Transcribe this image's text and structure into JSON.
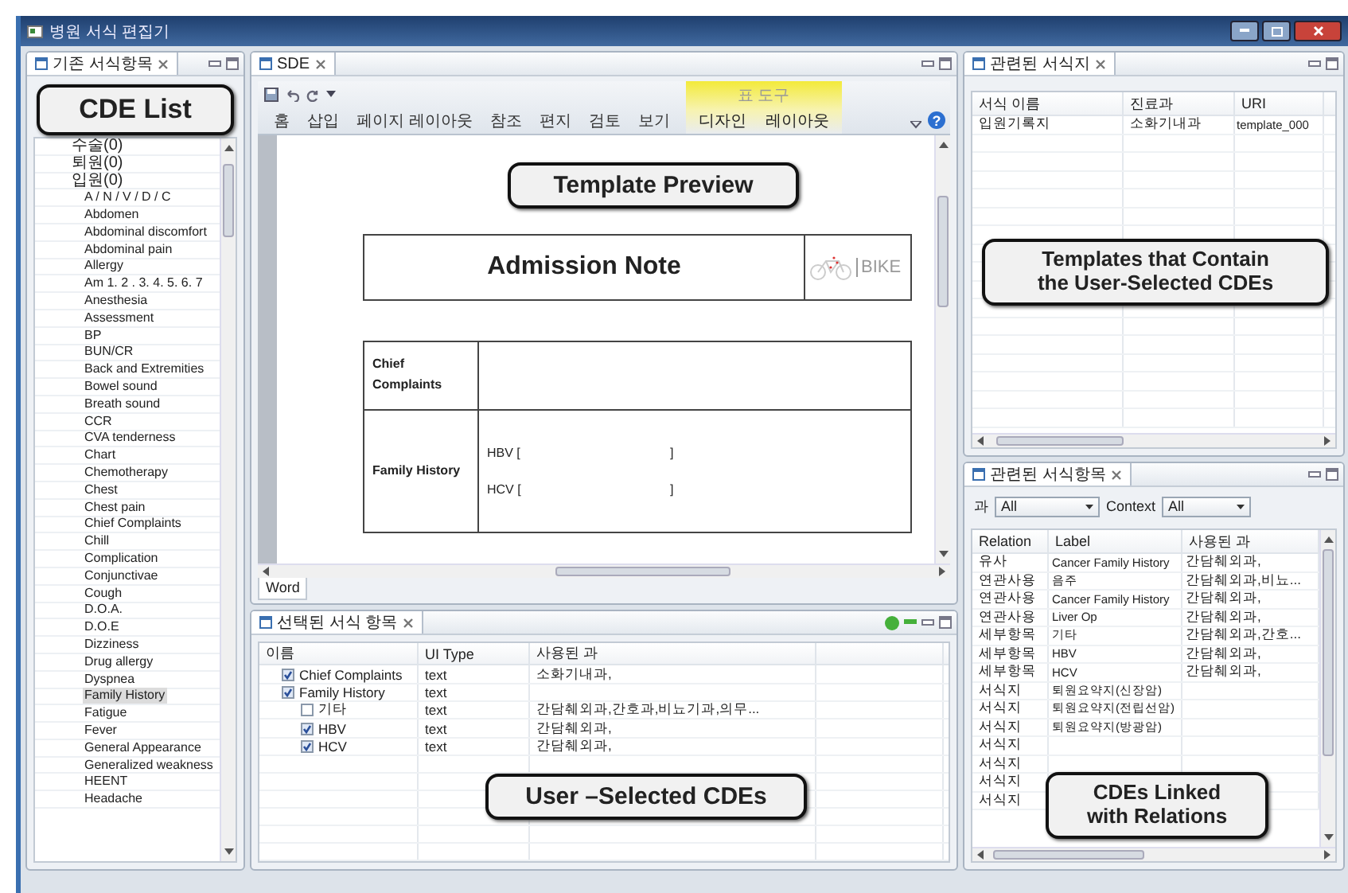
{
  "window": {
    "title": "병원 서식 편집기"
  },
  "cde_panel": {
    "tab": "기존 서식항목",
    "callout": "CDE List",
    "tree": [
      {
        "label": "수술(0)",
        "selected": false
      },
      {
        "label": "퇴원(0)",
        "selected": false
      },
      {
        "label": "입원(0)",
        "selected": false,
        "children": [
          {
            "label": "A / N / V / D / C",
            "selected": false
          },
          {
            "label": "Abdomen",
            "selected": false
          },
          {
            "label": "Abdominal discomfort",
            "selected": false
          },
          {
            "label": "Abdominal pain",
            "selected": false
          },
          {
            "label": "Allergy",
            "selected": false
          },
          {
            "label": "Am 1. 2 . 3. 4. 5. 6. 7",
            "selected": false
          },
          {
            "label": "Anesthesia",
            "selected": false
          },
          {
            "label": "Assessment",
            "selected": false
          },
          {
            "label": "BP",
            "selected": false
          },
          {
            "label": "BUN/CR",
            "selected": false
          },
          {
            "label": "Back and Extremities",
            "selected": false
          },
          {
            "label": "Bowel sound",
            "selected": false
          },
          {
            "label": "Breath sound",
            "selected": false
          },
          {
            "label": "CCR",
            "selected": false
          },
          {
            "label": "CVA tenderness",
            "selected": false
          },
          {
            "label": "Chart",
            "selected": false
          },
          {
            "label": "Chemotherapy",
            "selected": false
          },
          {
            "label": "Chest",
            "selected": false
          },
          {
            "label": "Chest pain",
            "selected": false
          },
          {
            "label": "Chief Complaints",
            "selected": false
          },
          {
            "label": "Chill",
            "selected": false
          },
          {
            "label": "Complication",
            "selected": false
          },
          {
            "label": "Conjunctivae",
            "selected": false
          },
          {
            "label": "Cough",
            "selected": false
          },
          {
            "label": "D.O.A.",
            "selected": false
          },
          {
            "label": "D.O.E",
            "selected": false
          },
          {
            "label": "Dizziness",
            "selected": false
          },
          {
            "label": "Drug allergy",
            "selected": false
          },
          {
            "label": "Dyspnea",
            "selected": false
          },
          {
            "label": "Family History",
            "selected": true
          },
          {
            "label": "Fatigue",
            "selected": false
          },
          {
            "label": "Fever",
            "selected": false
          },
          {
            "label": "General Appearance",
            "selected": false
          },
          {
            "label": "Generalized weakness",
            "selected": false
          },
          {
            "label": "HEENT",
            "selected": false
          },
          {
            "label": "Headache",
            "selected": false
          }
        ]
      }
    ]
  },
  "editor": {
    "tab": "SDE",
    "context_group": "표 도구",
    "help": "?",
    "ribbon_tabs": [
      {
        "label": "홈",
        "contextual": false
      },
      {
        "label": "삽입",
        "contextual": false
      },
      {
        "label": "페이지 레이아웃",
        "contextual": false
      },
      {
        "label": "참조",
        "contextual": false
      },
      {
        "label": "편지",
        "contextual": false
      },
      {
        "label": "검토",
        "contextual": false
      },
      {
        "label": "보기",
        "contextual": false
      },
      {
        "label": "디자인",
        "contextual": true
      },
      {
        "label": "레이아웃",
        "contextual": true
      }
    ],
    "callout": "Template Preview",
    "document": {
      "title": "Admission Note",
      "logo_text": "BIKE",
      "rows": [
        {
          "label": "Chief Complaints",
          "fields": []
        },
        {
          "label": "Family History",
          "fields": [
            {
              "label": "HBV [",
              "end": "]"
            },
            {
              "label": "HCV [",
              "end": "]"
            }
          ]
        }
      ]
    },
    "bottom_tab": "Word"
  },
  "selected_panel": {
    "tab": "선택된 서식 항목",
    "callout": "User –Selected CDEs",
    "columns": [
      "이름",
      "UI Type",
      "사용된 과"
    ],
    "rows": [
      {
        "name": "Chief Complaints",
        "checked": true,
        "ui_type": "text",
        "departments": "소화기내과,"
      },
      {
        "name": "Family History",
        "checked": true,
        "ui_type": "text",
        "children": [
          {
            "name": "기타",
            "checked": false,
            "ui_type": "text",
            "departments": "간담췌외과,간호과,비뇨기과,의무..."
          },
          {
            "name": "HBV",
            "checked": true,
            "ui_type": "text",
            "departments": "간담췌외과,"
          },
          {
            "name": "HCV",
            "checked": true,
            "ui_type": "text",
            "departments": "간담췌외과,"
          }
        ]
      }
    ]
  },
  "templates_panel": {
    "tab": "관련된 서식지",
    "callout": [
      "Templates that Contain",
      "the User-Selected CDEs"
    ],
    "columns": [
      "서식 이름",
      "진료과",
      "URI"
    ],
    "rows": [
      {
        "name": "입원기록지",
        "department": "소화기내과",
        "uri": "template_000"
      }
    ]
  },
  "relations_panel": {
    "tab": "관련된 서식항목",
    "callout": [
      "CDEs Linked",
      "with Relations"
    ],
    "filters": [
      {
        "label": "과",
        "value": "All"
      },
      {
        "label": "Context",
        "value": "All"
      }
    ],
    "columns": [
      "Relation",
      "Label",
      "사용된 과"
    ],
    "rows": [
      {
        "relation": "유사",
        "label": "Cancer Family History",
        "departments": "간담췌외과,"
      },
      {
        "relation": "연관사용",
        "label": "음주",
        "departments": "간담췌외과,비뇨..."
      },
      {
        "relation": "연관사용",
        "label": "Cancer Family History",
        "departments": "간담췌외과,"
      },
      {
        "relation": "연관사용",
        "label": "Liver Op",
        "departments": "간담췌외과,"
      },
      {
        "relation": "세부항목",
        "label": "기타",
        "departments": "간담췌외과,간호..."
      },
      {
        "relation": "세부항목",
        "label": "HBV",
        "departments": "간담췌외과,"
      },
      {
        "relation": "세부항목",
        "label": "HCV",
        "departments": "간담췌외과,"
      },
      {
        "relation": "서식지",
        "label": "퇴원요약지(신장암)"
      },
      {
        "relation": "서식지",
        "label": "퇴원요약지(전립선암)"
      },
      {
        "relation": "서식지",
        "label": "퇴원요약지(방광암)"
      },
      {
        "relation": "서식지"
      },
      {
        "relation": "서식지"
      },
      {
        "relation": "서식지"
      },
      {
        "relation": "서식지"
      }
    ]
  }
}
